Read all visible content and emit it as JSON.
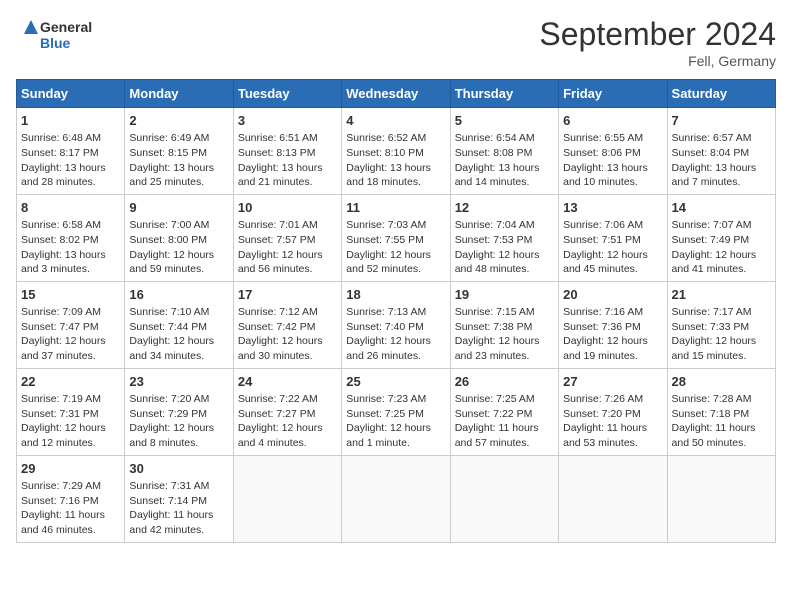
{
  "logo": {
    "line1": "General",
    "line2": "Blue"
  },
  "title": "September 2024",
  "location": "Fell, Germany",
  "headers": [
    "Sunday",
    "Monday",
    "Tuesday",
    "Wednesday",
    "Thursday",
    "Friday",
    "Saturday"
  ],
  "weeks": [
    [
      {
        "day": "1",
        "lines": [
          "Sunrise: 6:48 AM",
          "Sunset: 8:17 PM",
          "Daylight: 13 hours",
          "and 28 minutes."
        ]
      },
      {
        "day": "2",
        "lines": [
          "Sunrise: 6:49 AM",
          "Sunset: 8:15 PM",
          "Daylight: 13 hours",
          "and 25 minutes."
        ]
      },
      {
        "day": "3",
        "lines": [
          "Sunrise: 6:51 AM",
          "Sunset: 8:13 PM",
          "Daylight: 13 hours",
          "and 21 minutes."
        ]
      },
      {
        "day": "4",
        "lines": [
          "Sunrise: 6:52 AM",
          "Sunset: 8:10 PM",
          "Daylight: 13 hours",
          "and 18 minutes."
        ]
      },
      {
        "day": "5",
        "lines": [
          "Sunrise: 6:54 AM",
          "Sunset: 8:08 PM",
          "Daylight: 13 hours",
          "and 14 minutes."
        ]
      },
      {
        "day": "6",
        "lines": [
          "Sunrise: 6:55 AM",
          "Sunset: 8:06 PM",
          "Daylight: 13 hours",
          "and 10 minutes."
        ]
      },
      {
        "day": "7",
        "lines": [
          "Sunrise: 6:57 AM",
          "Sunset: 8:04 PM",
          "Daylight: 13 hours",
          "and 7 minutes."
        ]
      }
    ],
    [
      {
        "day": "8",
        "lines": [
          "Sunrise: 6:58 AM",
          "Sunset: 8:02 PM",
          "Daylight: 13 hours",
          "and 3 minutes."
        ]
      },
      {
        "day": "9",
        "lines": [
          "Sunrise: 7:00 AM",
          "Sunset: 8:00 PM",
          "Daylight: 12 hours",
          "and 59 minutes."
        ]
      },
      {
        "day": "10",
        "lines": [
          "Sunrise: 7:01 AM",
          "Sunset: 7:57 PM",
          "Daylight: 12 hours",
          "and 56 minutes."
        ]
      },
      {
        "day": "11",
        "lines": [
          "Sunrise: 7:03 AM",
          "Sunset: 7:55 PM",
          "Daylight: 12 hours",
          "and 52 minutes."
        ]
      },
      {
        "day": "12",
        "lines": [
          "Sunrise: 7:04 AM",
          "Sunset: 7:53 PM",
          "Daylight: 12 hours",
          "and 48 minutes."
        ]
      },
      {
        "day": "13",
        "lines": [
          "Sunrise: 7:06 AM",
          "Sunset: 7:51 PM",
          "Daylight: 12 hours",
          "and 45 minutes."
        ]
      },
      {
        "day": "14",
        "lines": [
          "Sunrise: 7:07 AM",
          "Sunset: 7:49 PM",
          "Daylight: 12 hours",
          "and 41 minutes."
        ]
      }
    ],
    [
      {
        "day": "15",
        "lines": [
          "Sunrise: 7:09 AM",
          "Sunset: 7:47 PM",
          "Daylight: 12 hours",
          "and 37 minutes."
        ]
      },
      {
        "day": "16",
        "lines": [
          "Sunrise: 7:10 AM",
          "Sunset: 7:44 PM",
          "Daylight: 12 hours",
          "and 34 minutes."
        ]
      },
      {
        "day": "17",
        "lines": [
          "Sunrise: 7:12 AM",
          "Sunset: 7:42 PM",
          "Daylight: 12 hours",
          "and 30 minutes."
        ]
      },
      {
        "day": "18",
        "lines": [
          "Sunrise: 7:13 AM",
          "Sunset: 7:40 PM",
          "Daylight: 12 hours",
          "and 26 minutes."
        ]
      },
      {
        "day": "19",
        "lines": [
          "Sunrise: 7:15 AM",
          "Sunset: 7:38 PM",
          "Daylight: 12 hours",
          "and 23 minutes."
        ]
      },
      {
        "day": "20",
        "lines": [
          "Sunrise: 7:16 AM",
          "Sunset: 7:36 PM",
          "Daylight: 12 hours",
          "and 19 minutes."
        ]
      },
      {
        "day": "21",
        "lines": [
          "Sunrise: 7:17 AM",
          "Sunset: 7:33 PM",
          "Daylight: 12 hours",
          "and 15 minutes."
        ]
      }
    ],
    [
      {
        "day": "22",
        "lines": [
          "Sunrise: 7:19 AM",
          "Sunset: 7:31 PM",
          "Daylight: 12 hours",
          "and 12 minutes."
        ]
      },
      {
        "day": "23",
        "lines": [
          "Sunrise: 7:20 AM",
          "Sunset: 7:29 PM",
          "Daylight: 12 hours",
          "and 8 minutes."
        ]
      },
      {
        "day": "24",
        "lines": [
          "Sunrise: 7:22 AM",
          "Sunset: 7:27 PM",
          "Daylight: 12 hours",
          "and 4 minutes."
        ]
      },
      {
        "day": "25",
        "lines": [
          "Sunrise: 7:23 AM",
          "Sunset: 7:25 PM",
          "Daylight: 12 hours",
          "and 1 minute."
        ]
      },
      {
        "day": "26",
        "lines": [
          "Sunrise: 7:25 AM",
          "Sunset: 7:22 PM",
          "Daylight: 11 hours",
          "and 57 minutes."
        ]
      },
      {
        "day": "27",
        "lines": [
          "Sunrise: 7:26 AM",
          "Sunset: 7:20 PM",
          "Daylight: 11 hours",
          "and 53 minutes."
        ]
      },
      {
        "day": "28",
        "lines": [
          "Sunrise: 7:28 AM",
          "Sunset: 7:18 PM",
          "Daylight: 11 hours",
          "and 50 minutes."
        ]
      }
    ],
    [
      {
        "day": "29",
        "lines": [
          "Sunrise: 7:29 AM",
          "Sunset: 7:16 PM",
          "Daylight: 11 hours",
          "and 46 minutes."
        ]
      },
      {
        "day": "30",
        "lines": [
          "Sunrise: 7:31 AM",
          "Sunset: 7:14 PM",
          "Daylight: 11 hours",
          "and 42 minutes."
        ]
      },
      {
        "day": "",
        "lines": []
      },
      {
        "day": "",
        "lines": []
      },
      {
        "day": "",
        "lines": []
      },
      {
        "day": "",
        "lines": []
      },
      {
        "day": "",
        "lines": []
      }
    ]
  ]
}
